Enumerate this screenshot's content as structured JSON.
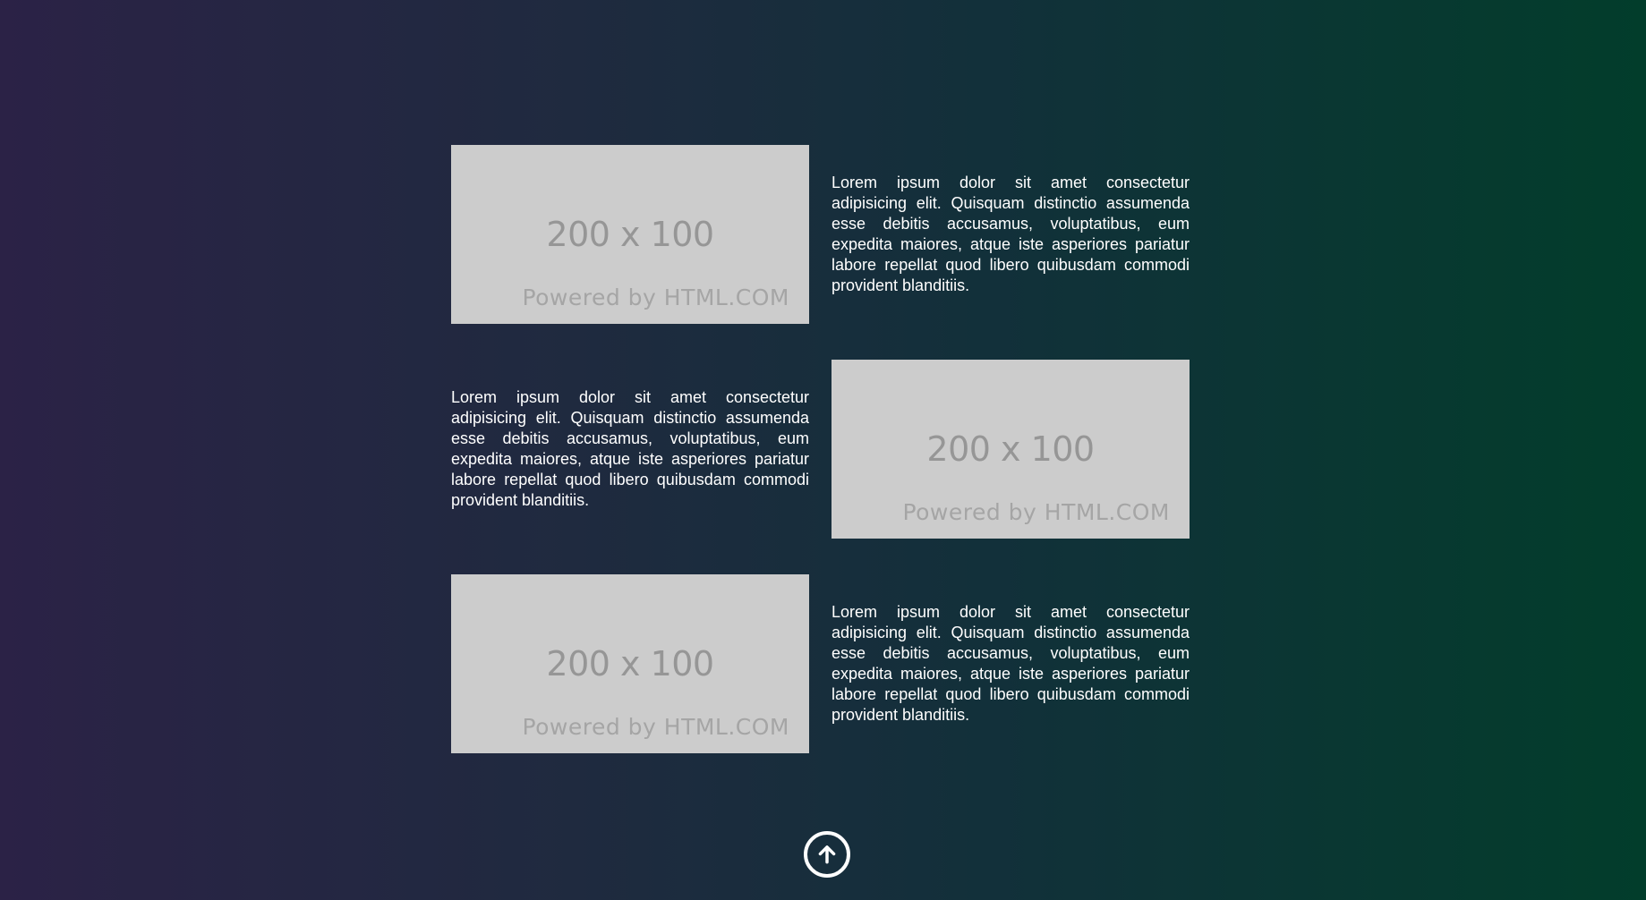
{
  "sections": [
    {
      "image": {
        "dims": "200 x 100",
        "powered": "Powered by HTML.COM"
      },
      "text": "Lorem ipsum dolor sit amet consectetur adipisicing elit. Quisquam distinctio assumenda esse debitis accusamus, voluptatibus, eum expedita maiores, atque iste asperiores pariatur labore repellat quod libero quibusdam commodi provident blanditiis."
    },
    {
      "image": {
        "dims": "200 x 100",
        "powered": "Powered by HTML.COM"
      },
      "text": "Lorem ipsum dolor sit amet consectetur adipisicing elit. Quisquam distinctio assumenda esse debitis accusamus, voluptatibus, eum expedita maiores, atque iste asperiores pariatur labore repellat quod libero quibusdam commodi provident blanditiis."
    },
    {
      "image": {
        "dims": "200 x 100",
        "powered": "Powered by HTML.COM"
      },
      "text": "Lorem ipsum dolor sit amet consectetur adipisicing elit. Quisquam distinctio assumenda esse debitis accusamus, voluptatibus, eum expedita maiores, atque iste asperiores pariatur labore repellat quod libero quibusdam commodi provident blanditiis."
    }
  ],
  "scroll_top": {
    "icon": "arrow-up-circle-icon"
  },
  "colors": {
    "gradient_left": "#2b2246",
    "gradient_right": "#023d2b",
    "placeholder_bg": "#cccccc",
    "text": "#ffffff"
  }
}
